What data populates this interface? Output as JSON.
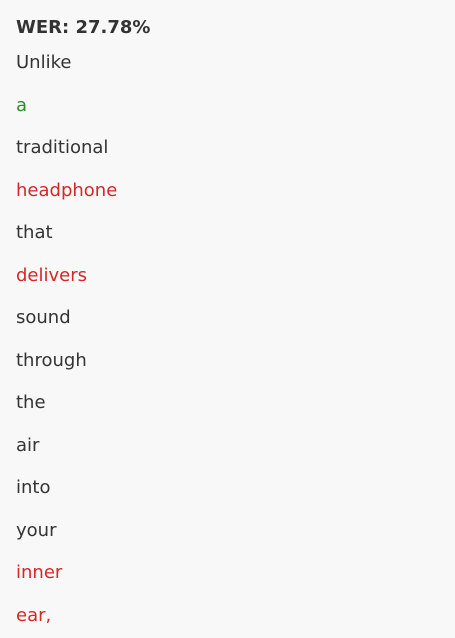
{
  "wer_label": "WER: 27.78%",
  "colors": {
    "correct": "#333333",
    "error": "#d62728",
    "insertion": "#2e8b2e",
    "background": "#f8f8f8"
  },
  "words": [
    {
      "text": "Unlike",
      "status": "correct"
    },
    {
      "text": "a",
      "status": "insertion"
    },
    {
      "text": "traditional",
      "status": "correct"
    },
    {
      "text": "headphone",
      "status": "substitution"
    },
    {
      "text": "that",
      "status": "correct"
    },
    {
      "text": "delivers",
      "status": "substitution"
    },
    {
      "text": "sound",
      "status": "correct"
    },
    {
      "text": "through",
      "status": "correct"
    },
    {
      "text": "the",
      "status": "correct"
    },
    {
      "text": "air",
      "status": "correct"
    },
    {
      "text": "into",
      "status": "correct"
    },
    {
      "text": "your",
      "status": "correct"
    },
    {
      "text": "inner",
      "status": "substitution"
    },
    {
      "text": "ear,",
      "status": "substitution"
    }
  ]
}
